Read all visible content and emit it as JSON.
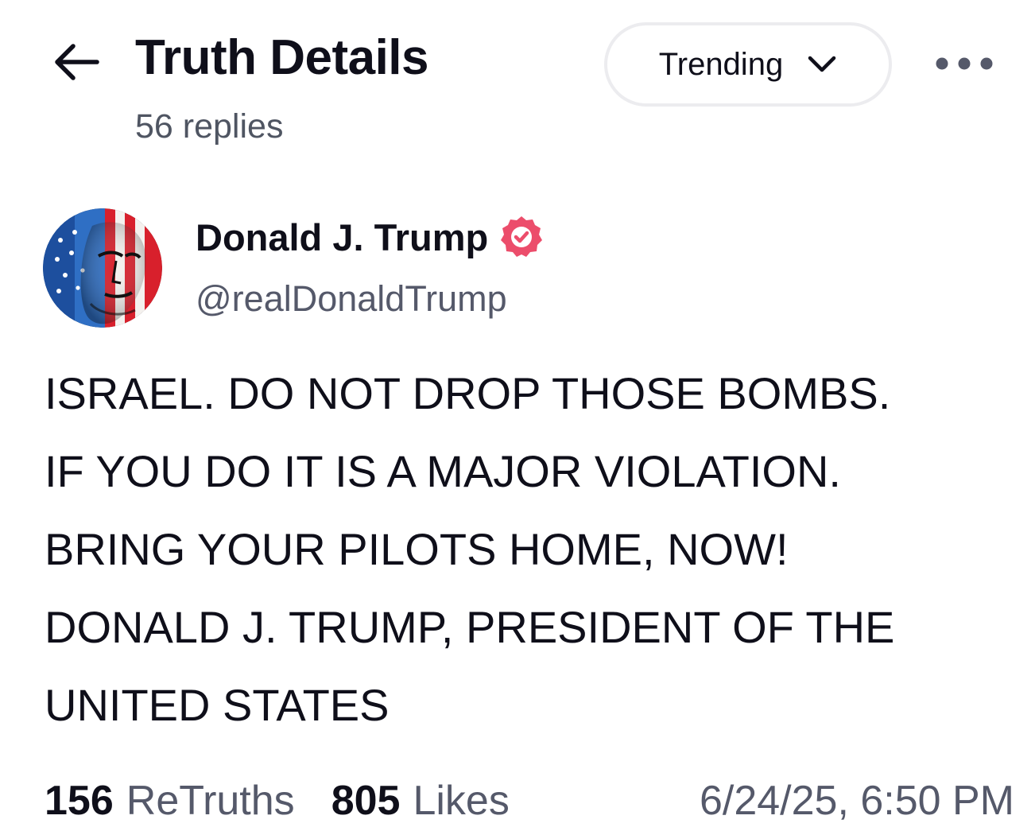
{
  "header": {
    "title": "Truth Details",
    "replies": "56 replies",
    "sort_label": "Trending",
    "back_icon": "arrow-left-icon",
    "sort_icon": "chevron-down-icon",
    "more_icon": "more-horizontal-icon"
  },
  "author": {
    "display_name": "Donald J. Trump",
    "handle": "@realDonaldTrump",
    "verified_icon": "verified-badge-icon",
    "verified_color": "#ec4d6b"
  },
  "post": {
    "lines": [
      "ISRAEL. DO NOT DROP THOSE BOMBS.",
      "IF YOU DO IT IS A MAJOR VIOLATION.",
      "BRING YOUR PILOTS HOME, NOW!",
      "DONALD J. TRUMP, PRESIDENT OF THE",
      "UNITED STATES"
    ]
  },
  "stats": {
    "retruths_count": "156",
    "retruths_label": "ReTruths",
    "likes_count": "805",
    "likes_label": "Likes",
    "timestamp": "6/24/25, 6:50 PM"
  },
  "colors": {
    "text_primary": "#0f0f1a",
    "text_secondary": "#55596a",
    "border": "#ececef",
    "brand": "#ec4d6b"
  }
}
